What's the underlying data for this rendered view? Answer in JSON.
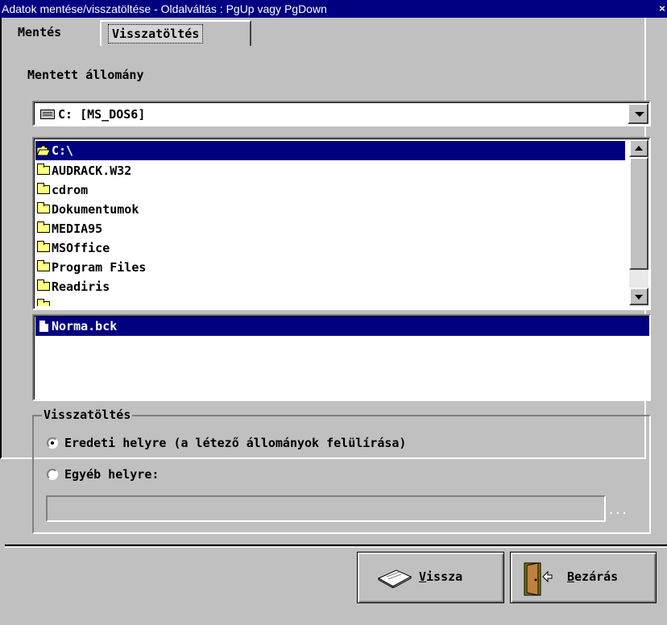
{
  "window": {
    "title": "Adatok mentése/visszatöltése - Oldalváltás : PgUp vagy PgDown",
    "close_glyph": "×"
  },
  "tabs": [
    {
      "label": "Mentés"
    },
    {
      "label": "Visszatöltés"
    }
  ],
  "saved_group": {
    "title": "Mentett állomány",
    "drive": {
      "value": "C:  [MS_DOS6]",
      "icon": "drive-icon"
    },
    "folders": {
      "current": "C:\\",
      "items": [
        "AUDRACK.W32",
        "cdrom",
        "Dokumentumok",
        "MEDIA95",
        "MSOffice",
        "Program Files",
        "Readiris"
      ]
    },
    "files": {
      "items": [
        "Norma.bck"
      ]
    }
  },
  "restore_group": {
    "title": "Visszatöltés",
    "options": [
      {
        "label": "Eredeti helyre (a létező állományok felülírása)",
        "selected": true
      },
      {
        "label": "Egyéb helyre:",
        "selected": false
      }
    ],
    "path_value": "",
    "browse_label": "..."
  },
  "buttons": {
    "back": {
      "label_prefix": "",
      "hotkey": "V",
      "label_rest": "issza"
    },
    "close": {
      "hotkey": "B",
      "label_rest": "ezárás"
    }
  },
  "colors": {
    "selection": "#000080",
    "face": "#c0c0c0"
  }
}
